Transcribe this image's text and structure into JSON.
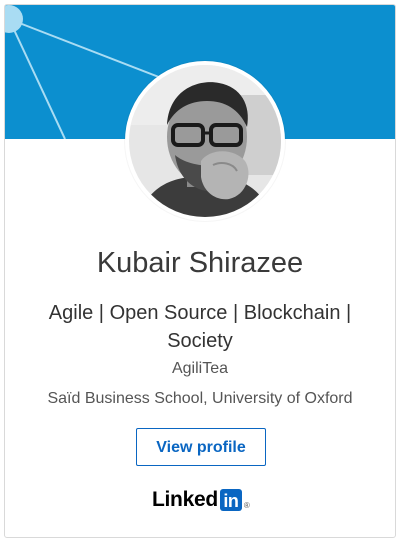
{
  "profile": {
    "name": "Kubair Shirazee",
    "headline": "Agile | Open Source | Blockchain | Society",
    "company": "AgiliTea",
    "school": "Saïd Business School, University of Oxford"
  },
  "actions": {
    "view_profile_label": "View profile"
  },
  "brand": {
    "word": "Linked",
    "box": "in",
    "registered": "®"
  },
  "colors": {
    "banner": "#0c8fcf",
    "linkedin_blue": "#0a66c2",
    "name_text": "#3a3a3a"
  }
}
